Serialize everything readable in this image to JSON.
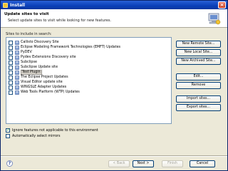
{
  "window": {
    "title": "Install"
  },
  "header": {
    "title": "Update sites to visit",
    "description": "Select update sites to visit while looking for new features."
  },
  "sites_label": "Sites to include in search:",
  "sites": [
    {
      "label": "Callisto Discovery Site"
    },
    {
      "label": "Eclipse Modeling Framework Technologies (EMFT) Updates"
    },
    {
      "label": "PyDEV"
    },
    {
      "label": "Pydev Extensions Discovery site"
    },
    {
      "label": "Subclipse"
    },
    {
      "label": "Subclipse Update site"
    },
    {
      "label": "Test Plugin"
    },
    {
      "label": "The Eclipse Project Updates"
    },
    {
      "label": "Visual Editor update site"
    },
    {
      "label": "WINGSLE Adapter Updates"
    },
    {
      "label": "Web Tools Platform (WTP) Updates"
    }
  ],
  "side_buttons": {
    "new_remote": "New Remote Site...",
    "new_local": "New Local Site...",
    "new_archived": "New Archived Site...",
    "edit": "Edit...",
    "remove": "Remove",
    "import": "Import sites...",
    "export": "Export sites..."
  },
  "options": {
    "ignore_features": "Ignore features not applicable to this environment",
    "auto_select_mirrors": "Automatically select mirrors"
  },
  "footer": {
    "back": "< Back",
    "next": "Next >",
    "finish": "Finish",
    "cancel": "Cancel"
  }
}
